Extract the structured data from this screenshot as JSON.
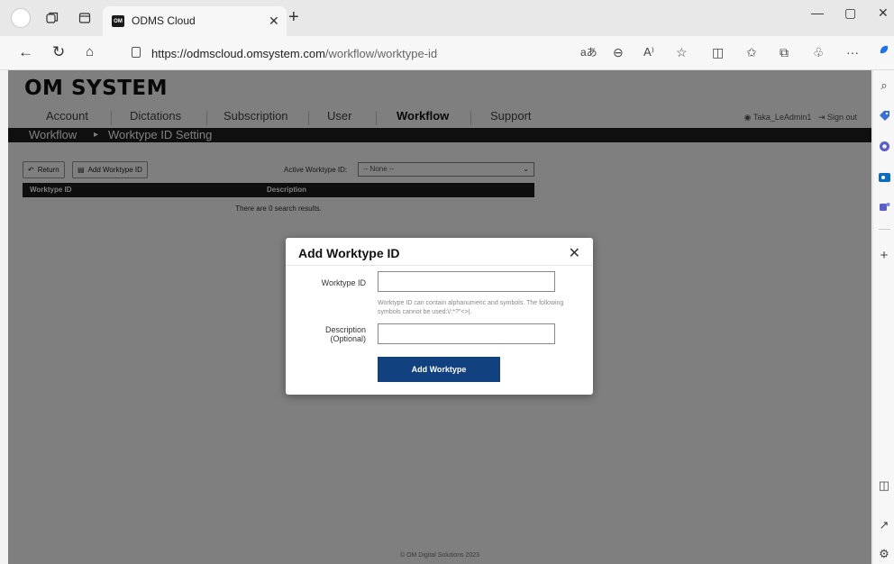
{
  "browser": {
    "tab_title": "ODMS Cloud",
    "tab_favicon_text": "OM",
    "url_host": "https://odmscloud.omsystem.com",
    "url_path": "/workflow/worktype-id",
    "translate_icon_text": "aあ",
    "read_aloud_icon_text": "A⁾"
  },
  "page": {
    "brand": "OM SYSTEM",
    "nav": {
      "account": "Account",
      "dictations": "Dictations",
      "subscription": "Subscription",
      "user": "User",
      "workflow": "Workflow",
      "support": "Support"
    },
    "user_name": "Taka_LeAdmin1",
    "sign_out": "Sign out",
    "breadcrumb": {
      "parent": "Workflow",
      "separator": "▸",
      "current": "Worktype ID Setting"
    },
    "toolbar": {
      "return_label": "Return",
      "add_label": "Add Worktype ID",
      "active_label": "Active Worktype ID:",
      "active_value": "-- None --"
    },
    "table": {
      "col_worktype_id": "Worktype ID",
      "col_description": "Description",
      "empty_message": "There are 0 search results."
    },
    "footer": "© OM Digital Solutions 2023"
  },
  "modal": {
    "title": "Add Worktype ID",
    "worktype_id_label": "Worktype ID",
    "worktype_id_value": "",
    "hint": "Worktype ID can contain alphanumeric and symbols. The following symbols cannot be used:\\/:*?\"<>|.",
    "description_label_1": "Description",
    "description_label_2": "(Optional)",
    "description_value": "",
    "submit_label": "Add Worktype"
  },
  "colors": {
    "accent": "#11427f",
    "header_bar": "#1f1f1f"
  }
}
